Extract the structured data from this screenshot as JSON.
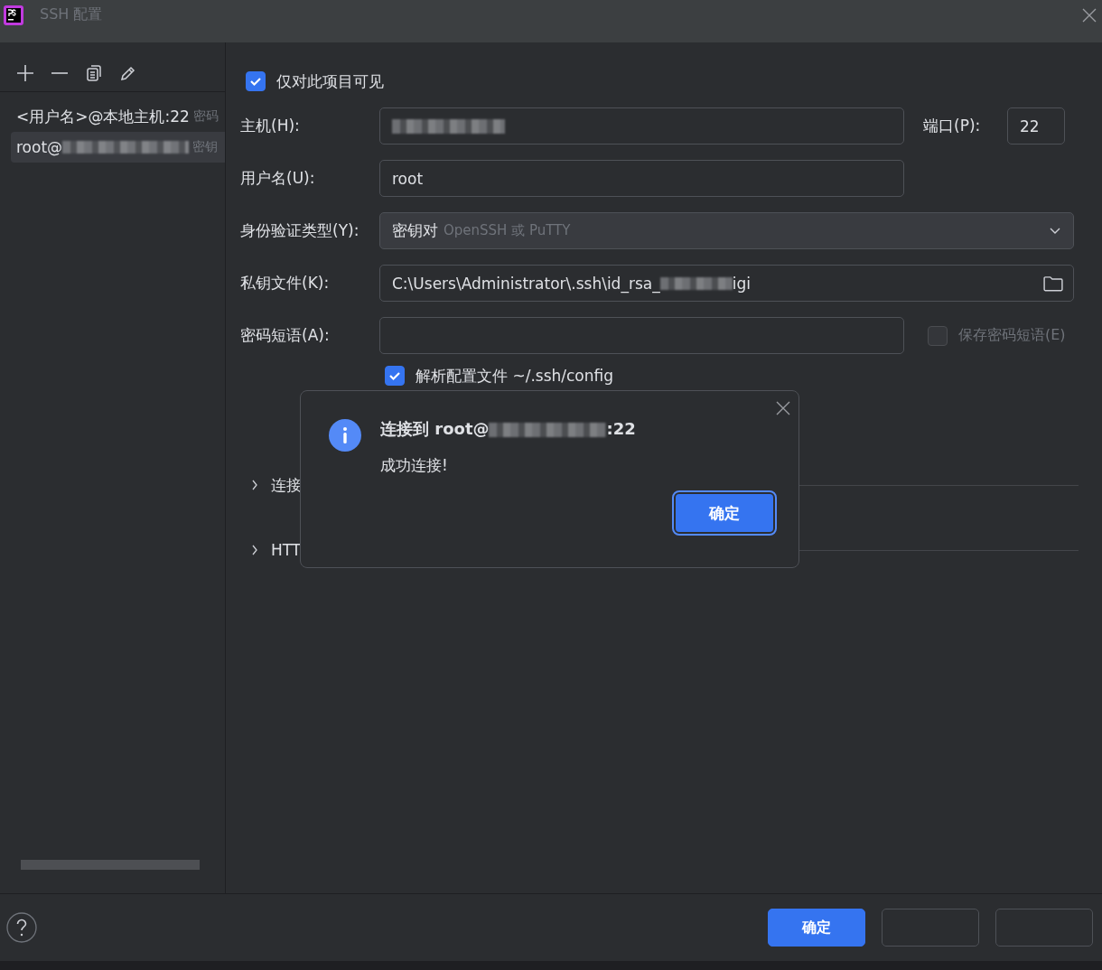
{
  "window": {
    "title": "SSH 配置"
  },
  "sidebar": {
    "items": [
      {
        "text": "<用户名>@本地主机:22",
        "hint": "密码",
        "selected": false
      },
      {
        "text": "root@",
        "hint": "密钥",
        "selected": true
      }
    ]
  },
  "form": {
    "visible_to_project": {
      "label": "仅对此项目可见",
      "checked": true
    },
    "host": {
      "label": "主机(H):"
    },
    "port": {
      "label": "端口(P):",
      "value": "22"
    },
    "username": {
      "label": "用户名(U):",
      "value": "root"
    },
    "auth_type": {
      "label": "身份验证类型(Y):",
      "value": "密钥对",
      "hint": "OpenSSH 或 PuTTY"
    },
    "key_file": {
      "label": "私钥文件(K):",
      "value": "C:\\Users\\Administrator\\.ssh\\id_rsa_",
      "value_end": "igi"
    },
    "passphrase": {
      "label": "密码短语(A):",
      "save": {
        "label": "保存密码短语(E)",
        "checked": false,
        "disabled": true
      }
    },
    "parse_config": {
      "label": "解析配置文件 ~/.ssh/config",
      "checked": true
    },
    "sections": [
      {
        "label": "连接",
        "expanded": false
      },
      {
        "label": "HTT",
        "expanded": false
      }
    ]
  },
  "dialog": {
    "title": "连接到 root@",
    "title_end": ":22",
    "message": "成功连接!",
    "button": "确定"
  },
  "footer": {
    "buttons": [
      {
        "label": "确定",
        "primary": true
      },
      {
        "primary": false
      },
      {
        "primary": false
      }
    ]
  }
}
